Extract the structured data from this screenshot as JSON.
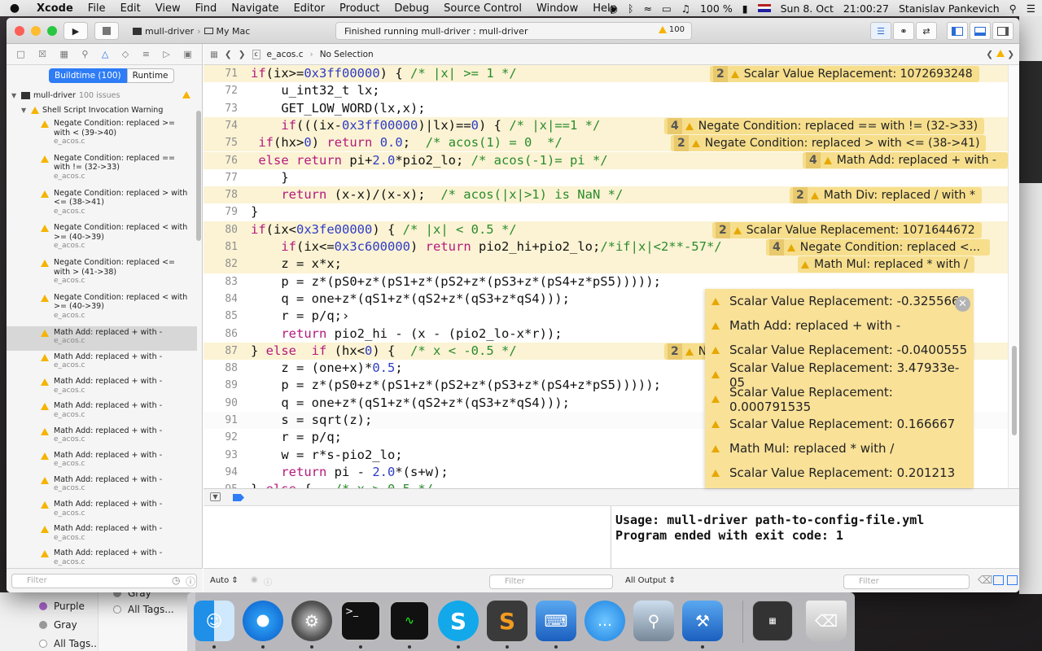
{
  "menubar": {
    "app": "Xcode",
    "items": [
      "File",
      "Edit",
      "View",
      "Find",
      "Navigate",
      "Editor",
      "Product",
      "Debug",
      "Source Control",
      "Window",
      "Help"
    ],
    "battery": "100 %",
    "date": "Sun 8. Oct",
    "time": "21:00:27",
    "user": "Stanislav Pankevich"
  },
  "toolbar": {
    "scheme": "mull-driver",
    "destination": "My Mac",
    "status": "Finished running mull-driver : mull-driver",
    "warning_count": "100"
  },
  "navigator": {
    "tab_buildtime": "Buildtime (100)",
    "tab_runtime": "Runtime",
    "project": "mull-driver",
    "project_issues": "100 issues",
    "group": "Shell Script Invocation Warning",
    "items": [
      {
        "t": "Negate Condition: replaced >= with < (39->40)",
        "f": "e_acos.c"
      },
      {
        "t": "Negate Condition: replaced == with != (32->33)",
        "f": "e_acos.c"
      },
      {
        "t": "Negate Condition: replaced > with <= (38->41)",
        "f": "e_acos.c"
      },
      {
        "t": "Negate Condition: replaced < with >= (40->39)",
        "f": "e_acos.c"
      },
      {
        "t": "Negate Condition: replaced <= with > (41->38)",
        "f": "e_acos.c"
      },
      {
        "t": "Negate Condition: replaced < with >= (40->39)",
        "f": "e_acos.c"
      },
      {
        "t": "Math Add: replaced + with -",
        "f": "e_acos.c"
      },
      {
        "t": "Math Add: replaced + with -",
        "f": "e_acos.c"
      },
      {
        "t": "Math Add: replaced + with -",
        "f": "e_acos.c"
      },
      {
        "t": "Math Add: replaced + with -",
        "f": "e_acos.c"
      },
      {
        "t": "Math Add: replaced + with -",
        "f": "e_acos.c"
      },
      {
        "t": "Math Add: replaced + with -",
        "f": "e_acos.c"
      },
      {
        "t": "Math Add: replaced + with -",
        "f": "e_acos.c"
      },
      {
        "t": "Math Add: replaced + with -",
        "f": "e_acos.c"
      },
      {
        "t": "Math Add: replaced + with -",
        "f": "e_acos.c"
      },
      {
        "t": "Math Add: replaced + with -",
        "f": "e_acos.c"
      }
    ],
    "filter_placeholder": "Filter"
  },
  "jumpbar": {
    "file": "e_acos.c",
    "selection": "No Selection"
  },
  "code": [
    {
      "n": "71",
      "hl": true
    },
    {
      "n": "72"
    },
    {
      "n": "73"
    },
    {
      "n": "74",
      "hl": true
    },
    {
      "n": "75",
      "hl": true
    },
    {
      "n": "76",
      "hl": true
    },
    {
      "n": "77"
    },
    {
      "n": "78",
      "hl": true
    },
    {
      "n": "79"
    },
    {
      "n": "80",
      "hl": true
    },
    {
      "n": "81",
      "hl": true
    },
    {
      "n": "82",
      "hl": true
    },
    {
      "n": "83"
    },
    {
      "n": "84"
    },
    {
      "n": "85"
    },
    {
      "n": "86"
    },
    {
      "n": "87",
      "hl": true
    },
    {
      "n": "88"
    },
    {
      "n": "89"
    },
    {
      "n": "90"
    },
    {
      "n": "91"
    },
    {
      "n": "92"
    },
    {
      "n": "93"
    },
    {
      "n": "94"
    },
    {
      "n": "95"
    }
  ],
  "badges": [
    {
      "count": "2",
      "text": "Scalar Value Replacement: 1072693248"
    },
    {
      "count": "4",
      "text": "Negate Condition: replaced == with != (32->33)"
    },
    {
      "count": "2",
      "text": "Negate Condition: replaced > with <= (38->41)"
    },
    {
      "count": "4",
      "text": "Math Add: replaced + with -"
    },
    {
      "count": "2",
      "text": "Math Div: replaced / with *"
    },
    {
      "count": "2",
      "text": "Scalar Value Replacement: 1071644672"
    },
    {
      "count": "4",
      "text": "Negate Condition: replaced <..."
    },
    {
      "count": "",
      "text": "Math Mul: replaced * with /"
    },
    {
      "count": "2",
      "text": "N"
    }
  ],
  "popup": [
    "Scalar Value Replacement: -0.325566",
    "Math Add: replaced + with -",
    "Scalar Value Replacement: -0.0400555",
    "Scalar Value Replacement: 3.47933e-05",
    "Scalar Value Replacement: 0.000791535",
    "Scalar Value Replacement: 0.166667",
    "Math Mul: replaced * with /",
    "Scalar Value Replacement: 0.201213"
  ],
  "debug": {
    "auto": "Auto",
    "output": "All Output",
    "filter": "Filter",
    "console": [
      "Usage: mull-driver path-to-config-file.yml",
      "Program ended with exit code: 1"
    ]
  },
  "finder_tags": [
    "Purple",
    "Gray",
    "All Tags..."
  ],
  "finder_behind": [
    "Gray",
    "All Tags..."
  ]
}
